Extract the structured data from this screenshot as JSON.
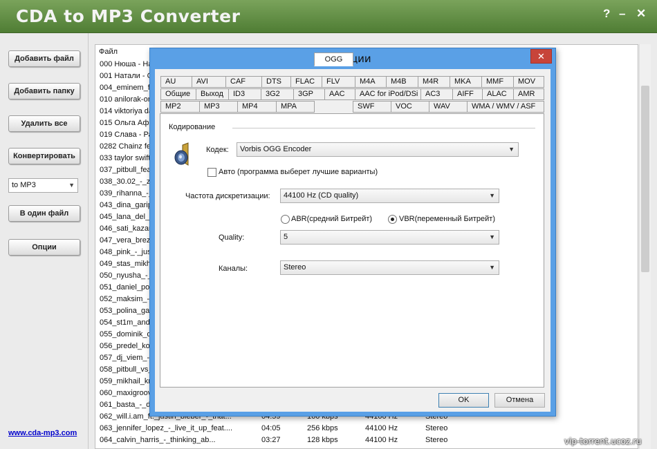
{
  "window": {
    "title": "CDA to MP3 Converter",
    "help": "?",
    "minimize": "–",
    "close": "✕"
  },
  "sidebar": {
    "buttons": [
      "Добавить файл",
      "Добавить папку",
      "Удалить все",
      "Конвертировать"
    ],
    "format_select": "to MP3",
    "single_file": "В один файл",
    "options": "Опции",
    "site_link": "www.cda-mp3.com"
  },
  "filelist": {
    "header": "Файл",
    "rows": [
      "000 Нюша - На",
      "001 Натали - С",
      "004_eminem_fe",
      "010 anilorak-ora",
      "014 viktoriya da",
      "015 Ольга Афа",
      "019 Слава - Ра",
      "0282  Chainz fe",
      "033 taylor swift",
      "037_pitbull_fea",
      "038_30.02_-_z",
      "039_rihanna_-_",
      "043_dina_garip",
      "045_lana_del_r",
      "046_sati_kazan",
      "047_vera_brez",
      "048_pink_-_jus",
      "049_stas_mikha",
      "050_nyusha_-_",
      "051_daniel_pow",
      "052_maksim_-_",
      "053_polina_gag",
      "054_st1m_and_",
      "055_dominik_dz",
      "056_predel_kor",
      "057_dj_viem_-_",
      "058_pitbull_vs_",
      "059_mikhail_kru",
      "060_maxigroov",
      "061_basta_-_d"
    ],
    "full_rows": [
      {
        "name": "062_will.i.am_ft._justin_bieber_-_that...",
        "duration": "04:59",
        "bitrate": "160 kbps",
        "rate": "44100 Hz",
        "channels": "Stereo"
      },
      {
        "name": "063_jennifer_lopez_-_live_it_up_feat....",
        "duration": "04:05",
        "bitrate": "256 kbps",
        "rate": "44100 Hz",
        "channels": "Stereo"
      },
      {
        "name": "064_calvin_harris_-_thinking_ab...",
        "duration": "03:27",
        "bitrate": "128 kbps",
        "rate": "44100 Hz",
        "channels": "Stereo"
      }
    ]
  },
  "dialog": {
    "title": "Опции",
    "close": "✕",
    "tabs_row1": [
      "AU",
      "AVI",
      "CAF",
      "DTS",
      "FLAC",
      "FLV",
      "M4A",
      "M4B",
      "M4R",
      "MKA",
      "MMF",
      "MOV"
    ],
    "tabs_row2": [
      "Общие",
      "Выход",
      "ID3",
      "3G2",
      "3GP",
      "AAC",
      "AAC for iPod/DSi",
      "AC3",
      "AIFF",
      "ALAC",
      "AMR"
    ],
    "tabs_row3": [
      "MP2",
      "MP3",
      "MP4",
      "MPA",
      "OGG",
      "SWF",
      "VOC",
      "WAV",
      "WMA / WMV / ASF"
    ],
    "active_tab": "OGG",
    "group_label": "Кодирование",
    "codec_label": "Кодек:",
    "codec_value": "Vorbis OGG Encoder",
    "auto_label": "Авто (программа выберет лучшие варианты)",
    "sample_rate_label": "Частота дискретизации:",
    "sample_rate_value": "44100 Hz (CD quality)",
    "abr_label": "ABR(средний Битрейт)",
    "vbr_label": "VBR(переменный Битрейт)",
    "quality_label": "Quality:",
    "quality_value": "5",
    "channels_label": "Каналы:",
    "channels_value": "Stereo",
    "ok": "OK",
    "cancel": "Отмена"
  },
  "watermark": "vip-torrent.ucoz.ru",
  "icons": {
    "speaker": "speaker-icon",
    "chevron": "chevron-down-icon"
  }
}
